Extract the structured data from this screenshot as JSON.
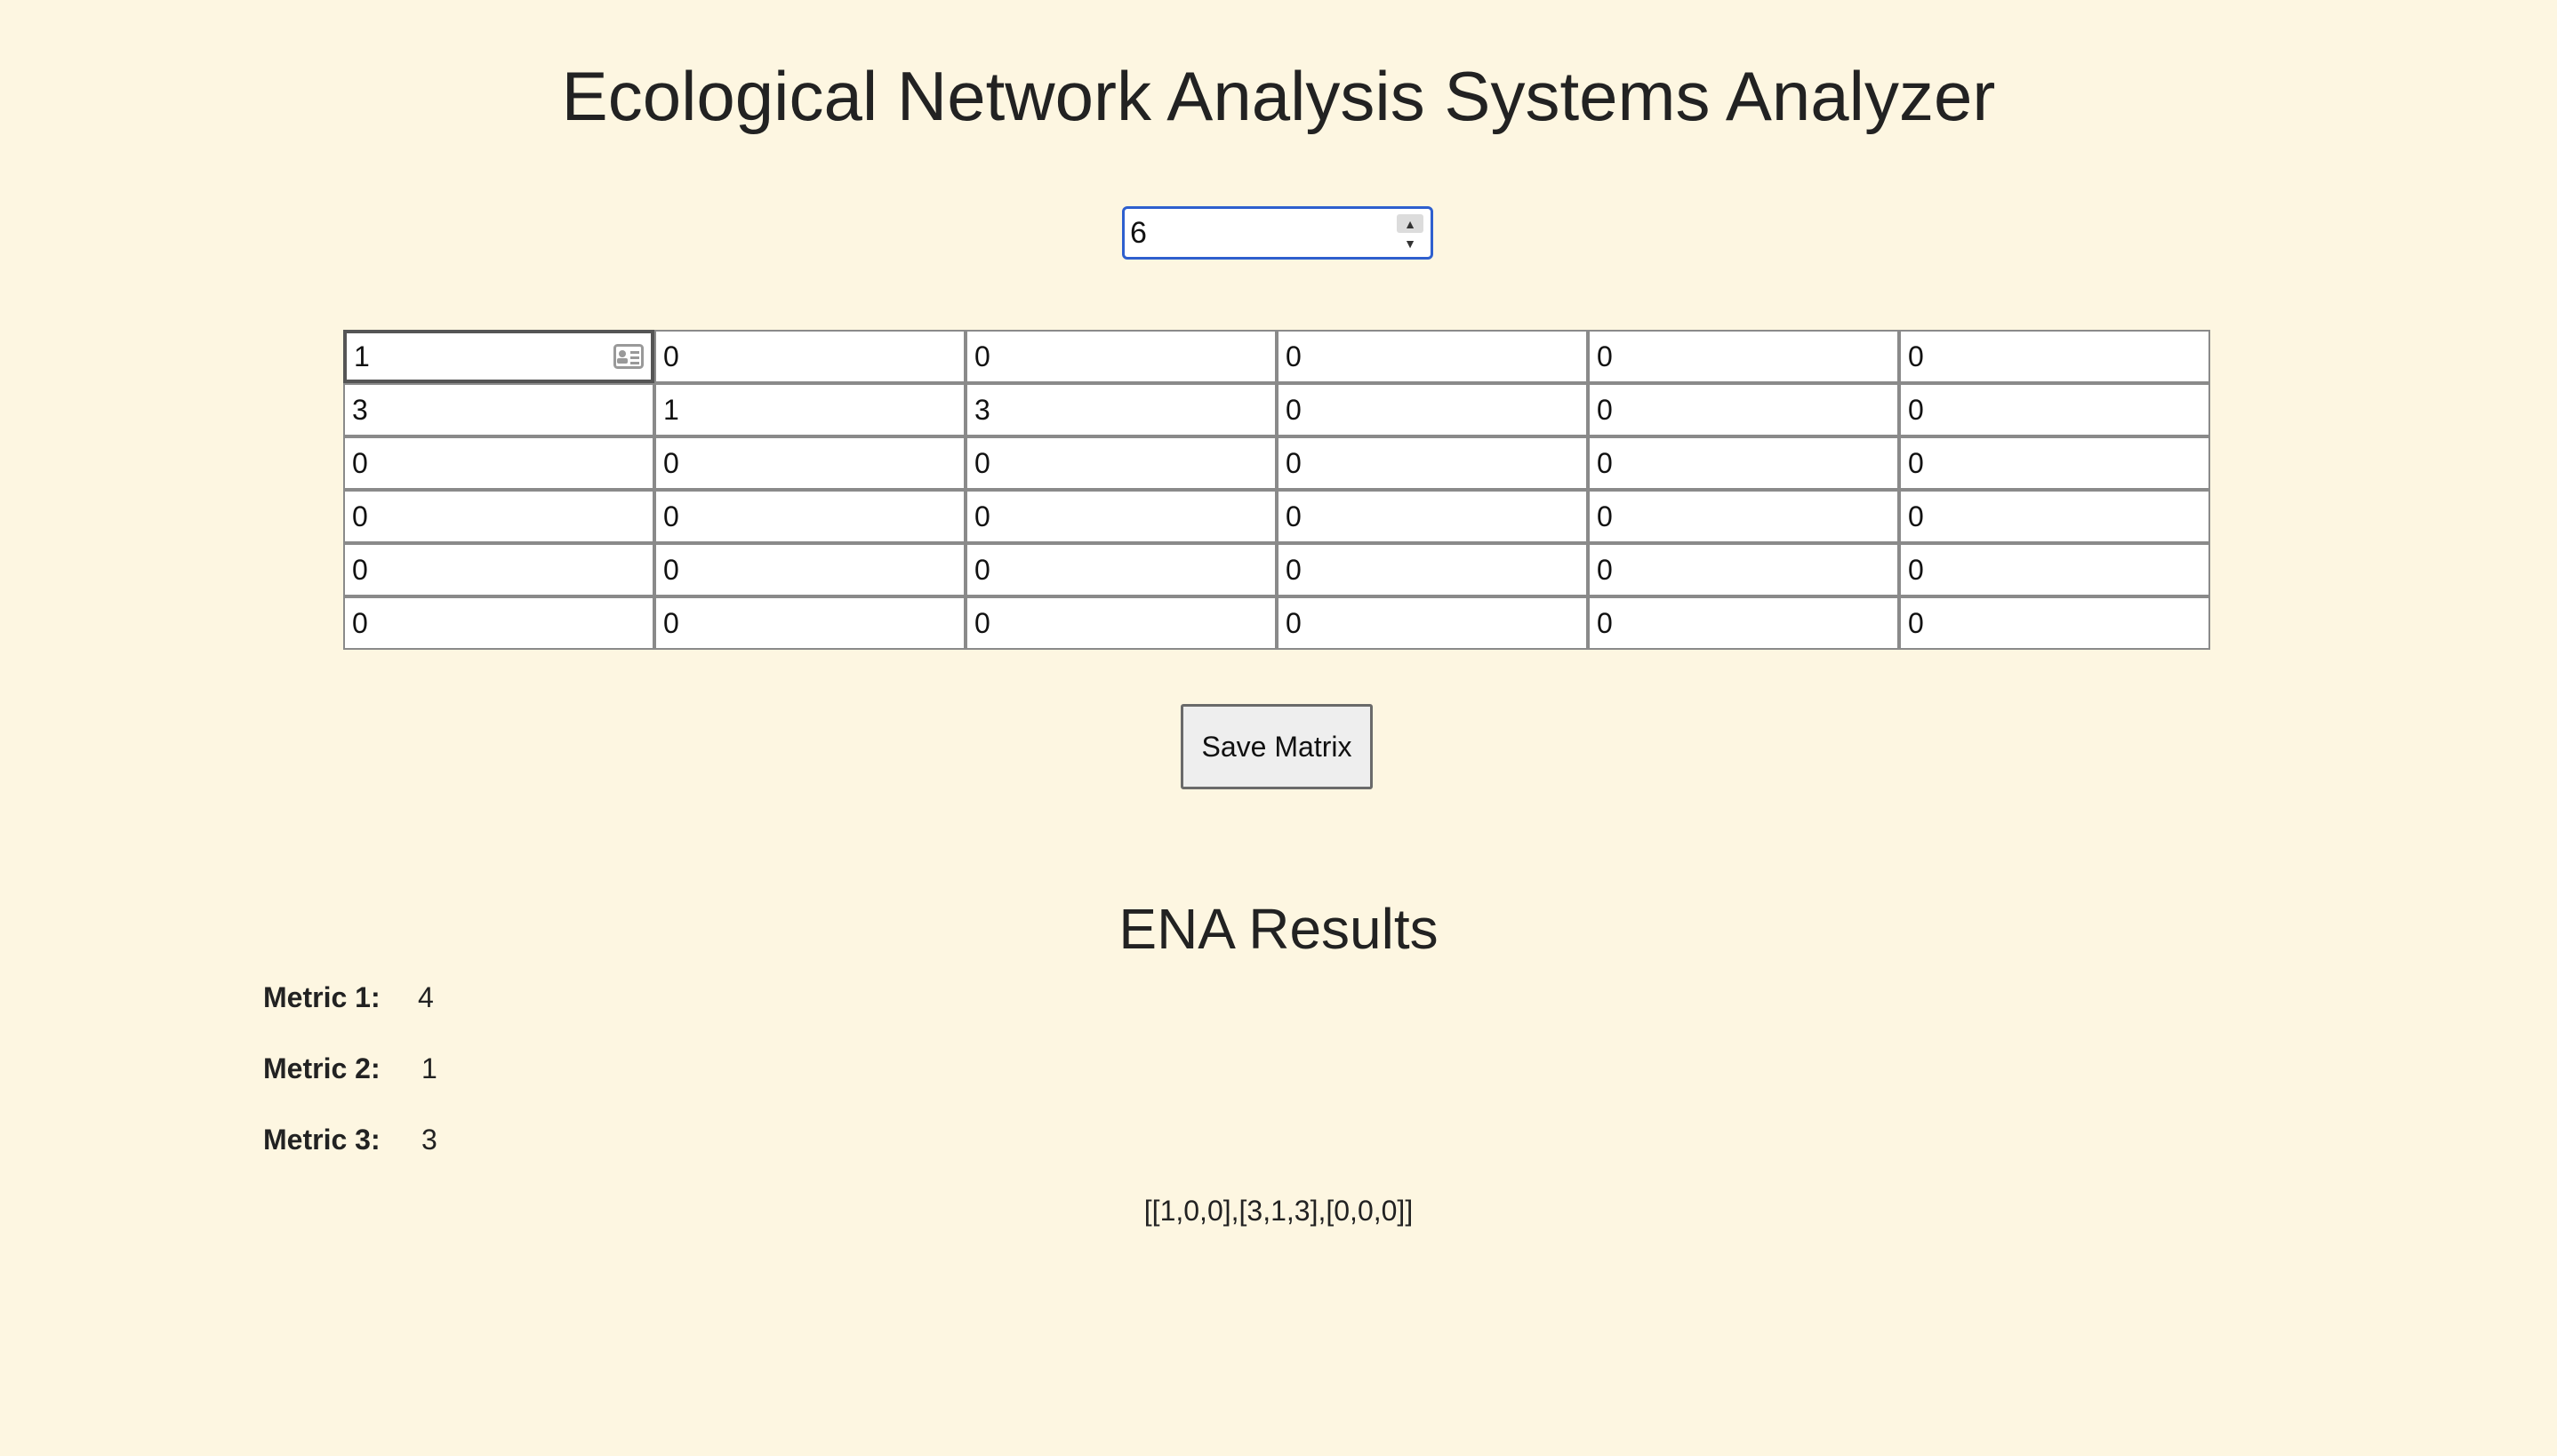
{
  "title": "Ecological Network Analysis Systems Analyzer",
  "size_input": {
    "value": "6"
  },
  "matrix": {
    "rows": [
      [
        "1",
        "0",
        "0",
        "0",
        "0",
        "0"
      ],
      [
        "3",
        "1",
        "3",
        "0",
        "0",
        "0"
      ],
      [
        "0",
        "0",
        "0",
        "0",
        "0",
        "0"
      ],
      [
        "0",
        "0",
        "0",
        "0",
        "0",
        "0"
      ],
      [
        "0",
        "0",
        "0",
        "0",
        "0",
        "0"
      ],
      [
        "0",
        "0",
        "0",
        "0",
        "0",
        "0"
      ]
    ]
  },
  "save_button": {
    "label": "Save Matrix"
  },
  "results": {
    "title": "ENA Results",
    "metrics": [
      {
        "label": "Metric 1:",
        "value": "4"
      },
      {
        "label": "Metric 2:",
        "value": "1"
      },
      {
        "label": "Metric 3:",
        "value": "3"
      }
    ],
    "matrix_string": "[[1,0,0],[3,1,3],[0,0,0]]"
  },
  "icons": {
    "autofill": "contact-card-icon",
    "spinner_up": "chevron-up-icon",
    "spinner_down": "chevron-down-icon"
  }
}
